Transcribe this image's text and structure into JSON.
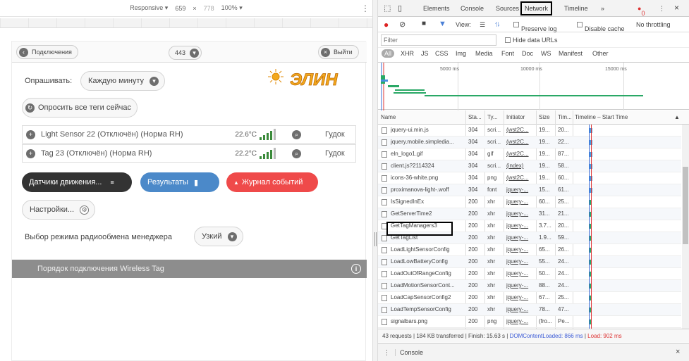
{
  "device_toolbar": {
    "device": "Responsive",
    "width": "659",
    "times": "×",
    "height": "778",
    "zoom": "100%",
    "kebab": "⋮"
  },
  "app": {
    "topbar": {
      "connect_label": "Подключения",
      "count": "443",
      "logout_label": "Выйти"
    },
    "poll_label": "Опрашивать:",
    "poll_value": "Каждую минуту",
    "poll_all_label": "Опросить все теги сейчас",
    "logo_text": "ЭЛИН",
    "sensors": [
      {
        "name": "Light Sensor 22 (Отключён) (Норма RH)",
        "temp": "22.6°C",
        "signal": 4,
        "action": "Гудок"
      },
      {
        "name": "Tag 23 (Отключён) (Норма RH)",
        "temp": "22.2°C",
        "signal": 4,
        "action": "Гудок"
      }
    ],
    "buttons": {
      "motion": "Датчики движения...",
      "results": "Результаты",
      "events": "Журнал событий",
      "settings": "Настройки..."
    },
    "radio_label": "Выбор режима радиообмена менеджера",
    "radio_value": "Узкий",
    "graybar_text": "Порядок подключения Wireless Tag",
    "colors": {
      "motion": "#333333",
      "results": "#4b89c9",
      "events": "#ef4a4a",
      "graybar": "#8d8d8d"
    }
  },
  "devtools": {
    "tabs": [
      "Elements",
      "Console",
      "Sources",
      "Network",
      "Timeline",
      "»"
    ],
    "active_tab": "Network",
    "error_badge": "0",
    "controls": {
      "view_label": "View:",
      "preserve_log": "Preserve log",
      "disable_cache": "Disable cache",
      "throttling": "No throttling"
    },
    "filter_placeholder": "Filter",
    "hide_data_urls": "Hide data URLs",
    "types": [
      "All",
      "XHR",
      "JS",
      "CSS",
      "Img",
      "Media",
      "Font",
      "Doc",
      "WS",
      "Manifest",
      "Other"
    ],
    "overview_ticks": [
      "5000 ms",
      "10000 ms",
      "15000 ms"
    ],
    "columns": [
      "Name",
      "Sta...",
      "Ty...",
      "Initiator",
      "Size",
      "Tim...",
      "Timeline – Start Time"
    ],
    "rows": [
      {
        "name": "jquery-ui.min.js",
        "status": "304",
        "type": "scri...",
        "initiator": "(wst2C...",
        "size": "19...",
        "time": "20..."
      },
      {
        "name": "jquery.mobile.simpledia...",
        "status": "304",
        "type": "scri...",
        "initiator": "(wst2C...",
        "size": "19...",
        "time": "22..."
      },
      {
        "name": "eln_logo1.gif",
        "status": "304",
        "type": "gif",
        "initiator": "(wst2C...",
        "size": "19...",
        "time": "87..."
      },
      {
        "name": "client.js?2114324",
        "status": "304",
        "type": "scri...",
        "initiator": "(index)",
        "size": "19...",
        "time": "58..."
      },
      {
        "name": "icons-36-white.png",
        "status": "304",
        "type": "png",
        "initiator": "(wst2C...",
        "size": "19...",
        "time": "60..."
      },
      {
        "name": "proximanova-light-.woff",
        "status": "304",
        "type": "font",
        "initiator": "jquery-...",
        "size": "15...",
        "time": "61..."
      },
      {
        "name": "IsSignedInEx",
        "status": "200",
        "type": "xhr",
        "initiator": "jquery-...",
        "size": "60...",
        "time": "25..."
      },
      {
        "name": "GetServerTime2",
        "status": "200",
        "type": "xhr",
        "initiator": "jquery-...",
        "size": "31...",
        "time": "21..."
      },
      {
        "name": "GetTagManagers3",
        "status": "200",
        "type": "xhr",
        "initiator": "jquery-...",
        "size": "3.7...",
        "time": "20..."
      },
      {
        "name": "GetTagList",
        "status": "200",
        "type": "xhr",
        "initiator": "jquery-...",
        "size": "1.9...",
        "time": "59..."
      },
      {
        "name": "LoadLightSensorConfig",
        "status": "200",
        "type": "xhr",
        "initiator": "jquery-...",
        "size": "65...",
        "time": "26..."
      },
      {
        "name": "LoadLowBatteryConfig",
        "status": "200",
        "type": "xhr",
        "initiator": "jquery-...",
        "size": "55...",
        "time": "24..."
      },
      {
        "name": "LoadOutOfRangeConfig",
        "status": "200",
        "type": "xhr",
        "initiator": "jquery-...",
        "size": "50...",
        "time": "24..."
      },
      {
        "name": "LoadMotionSensorCont...",
        "status": "200",
        "type": "xhr",
        "initiator": "jquery-...",
        "size": "88...",
        "time": "24..."
      },
      {
        "name": "LoadCapSensorConfig2",
        "status": "200",
        "type": "xhr",
        "initiator": "jquery-...",
        "size": "67...",
        "time": "25..."
      },
      {
        "name": "LoadTempSensorConfig",
        "status": "200",
        "type": "xhr",
        "initiator": "jquery-...",
        "size": "78...",
        "time": "47..."
      },
      {
        "name": "signalbars.png",
        "status": "200",
        "type": "png",
        "initiator": "jquery-...",
        "size": "(fro...",
        "time": "Pe..."
      }
    ],
    "status": {
      "requests": "43 requests | 184 KB transferred | Finish: 15.63 s | ",
      "dom": "DOMContentLoaded: 866 ms",
      "sep": " | ",
      "load": "Load: 902 ms"
    },
    "drawer": {
      "label": "Console"
    }
  }
}
